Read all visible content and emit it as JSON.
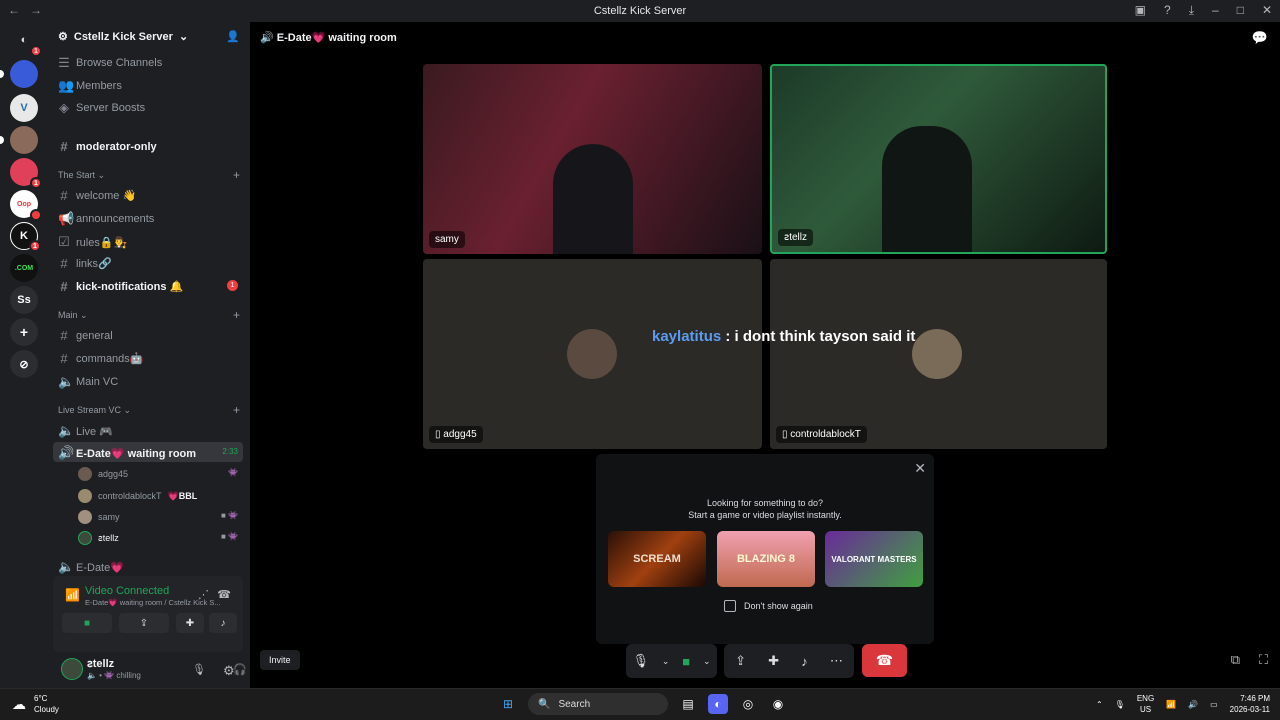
{
  "titlebar": {
    "title": "Cstellz Kick Server",
    "back": "←",
    "forward": "→",
    "icons": [
      "inbox-icon",
      "help-icon",
      "download-icon",
      "minimize-icon",
      "maximize-icon",
      "close-icon"
    ]
  },
  "server_rail": {
    "items": [
      {
        "name": "discord-home",
        "badge": "1"
      },
      {
        "name": "server-blue"
      },
      {
        "name": "server-v",
        "label": "V"
      },
      {
        "name": "server-photo"
      },
      {
        "name": "server-red",
        "badge": "1"
      },
      {
        "name": "server-oopbox",
        "badge": "2"
      },
      {
        "name": "server-kick",
        "badge": "1"
      },
      {
        "name": "server-com",
        "label": ".COM"
      },
      {
        "name": "server-ss",
        "label": "Ss"
      },
      {
        "name": "add-server",
        "label": "+"
      },
      {
        "name": "discover",
        "label": "⊘"
      }
    ]
  },
  "sidebar": {
    "server_name": "Cstellz Kick Server",
    "top_items": [
      "Browse Channels",
      "Members",
      "Server Boosts"
    ],
    "moderator": "moderator-only",
    "categories": [
      {
        "name": "The Start",
        "channels": [
          {
            "name": "welcome 👋"
          },
          {
            "name": "announcements"
          },
          {
            "name": "rules🔒👨‍⚖️"
          },
          {
            "name": "links🔗"
          },
          {
            "name": "kick-notifications 🔔",
            "badge": "1"
          }
        ]
      },
      {
        "name": "Main",
        "channels": [
          {
            "name": "general"
          },
          {
            "name": "commands🤖"
          },
          {
            "name": "Main VC"
          }
        ]
      },
      {
        "name": "Live Stream VC",
        "channels": [
          {
            "name": "Live 🎮"
          },
          {
            "name": "E-Date💗 waiting room",
            "time": "2:33"
          }
        ]
      }
    ],
    "voice_users": [
      {
        "name": "adgg45"
      },
      {
        "name": "controldablockT",
        "tag": "💗BBL"
      },
      {
        "name": "samy"
      },
      {
        "name": "ꙅtellz"
      }
    ],
    "last_channel": "E-Date💗"
  },
  "voice_panel": {
    "status": "Video Connected",
    "subtitle": "E-Date💗 waiting room / Cstellz Kick S..."
  },
  "user": {
    "name": "ꙅtellz",
    "status": "chilling"
  },
  "main": {
    "header": "E-Date💗 waiting room",
    "tiles": [
      {
        "name": "samy"
      },
      {
        "name": "ꙅtellz"
      },
      {
        "name": "adgg45"
      },
      {
        "name": "controldablockT"
      }
    ],
    "caption_user": "kaylatitus",
    "caption_text": " : i dont think tayson said it",
    "popup": {
      "line1": "Looking for something to do?",
      "line2": "Start a game or video playlist instantly.",
      "dont_show": "Don't show again",
      "games": [
        "SCREAM",
        "BLAZING 8",
        "VALORANT MASTERS"
      ]
    },
    "invite": "Invite"
  },
  "taskbar": {
    "temp": "6°C",
    "weather": "Cloudy",
    "search": "Search",
    "lang1": "ENG",
    "lang2": "US",
    "time": "7:46 PM",
    "date": "2026-03-11"
  }
}
